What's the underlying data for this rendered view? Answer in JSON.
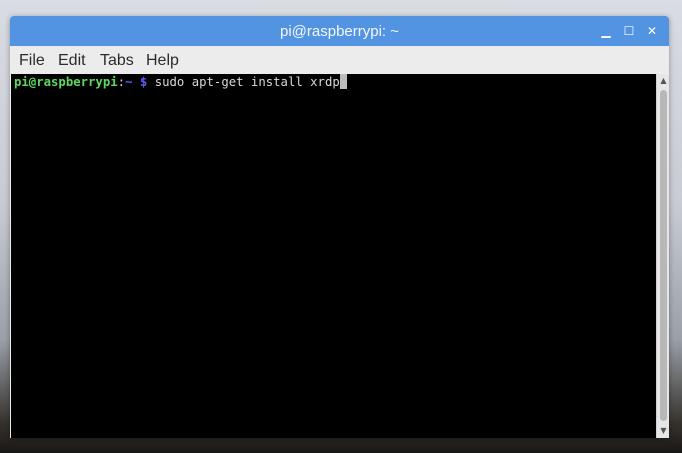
{
  "window": {
    "title": "pi@raspberrypi: ~",
    "minimize_icon": "minimize-icon",
    "maximize_icon": "maximize-icon",
    "close_icon": "close-icon"
  },
  "menu": {
    "items": [
      "File",
      "Edit",
      "Tabs",
      "Help"
    ]
  },
  "terminal": {
    "prompt_user_host": "pi@raspberrypi",
    "prompt_sep": ":",
    "prompt_path": "~",
    "prompt_symbol": " $ ",
    "command": "sudo apt-get install xrdp"
  },
  "colors": {
    "titlebar": "#5294e2",
    "prompt_user": "#5fd75f",
    "prompt_path": "#5c5cff",
    "terminal_bg": "#000000"
  }
}
